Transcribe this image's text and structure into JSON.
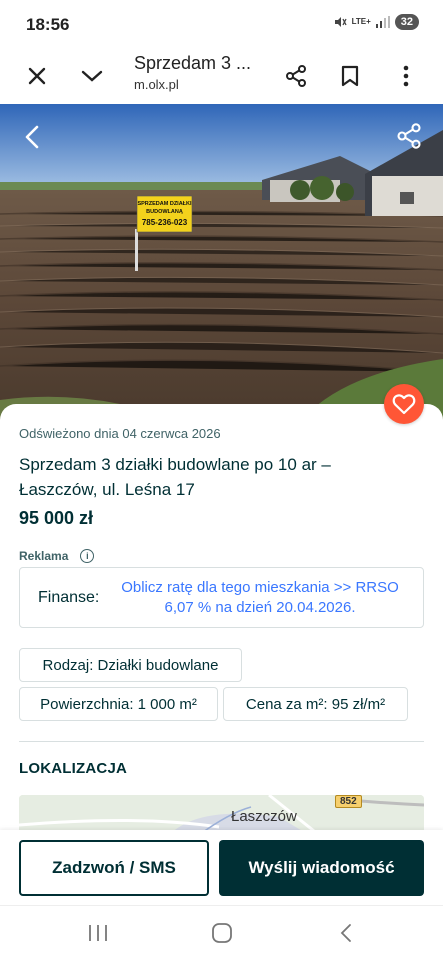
{
  "status_bar": {
    "time": "18:56",
    "network": "LTE+",
    "battery": "32"
  },
  "browser": {
    "title": "Sprzedam 3 ...",
    "url": "m.olx.pl"
  },
  "listing": {
    "refreshed": "Odświeżono dnia 04 czerwca 2026",
    "title": "Sprzedam 3 działki budowlane po 10 ar – Łaszczów, ul. Leśna 17",
    "price": "95 000 zł",
    "ad_label": "Reklama",
    "finance_label": "Finanse:",
    "finance_link": "Oblicz ratę dla tego mieszkania >> RRSO 6,07 % na dzień 20.04.2026.",
    "params": [
      "Rodzaj: Działki budowlane",
      "Powierzchnia: 1 000 m²",
      "Cena za m²: 95 zł/m²"
    ],
    "location_title": "LOKALIZACJA",
    "map_town": "Łaszczów",
    "map_road": "852"
  },
  "sign": {
    "line1": "SPRZEDAM DZIAŁKI",
    "line2": "BUDOWLANĄ",
    "phone": "785-236-023"
  },
  "actions": {
    "call": "Zadzwoń / SMS",
    "message": "Wyślij wiadomość"
  },
  "colors": {
    "brand_dark": "#002f34",
    "favorite": "#ff5636",
    "link": "#3a77ff"
  }
}
